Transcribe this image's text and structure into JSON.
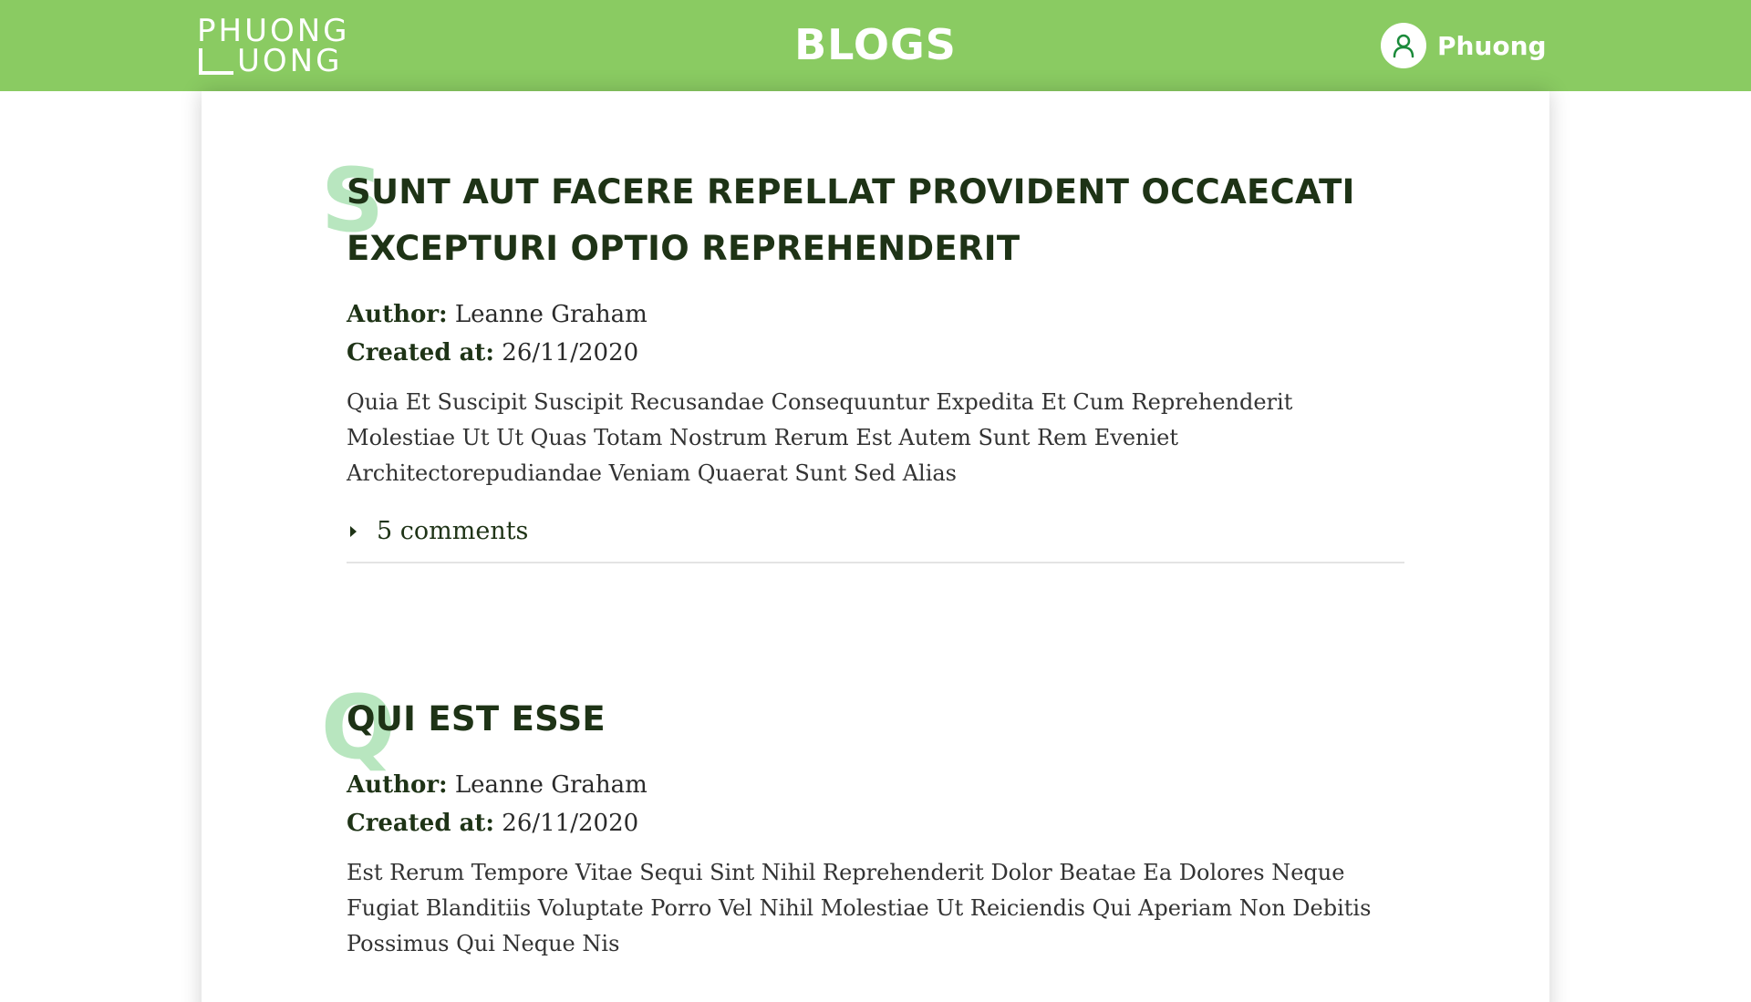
{
  "header": {
    "logo_line1": "PHUONG",
    "logo_line2": "UONG",
    "title": "BLOGS",
    "user_name": "Phuong",
    "user_icon": "user-icon"
  },
  "posts": [
    {
      "initial": "S",
      "title": "SUNT AUT FACERE REPELLAT PROVIDENT OCCAECATI EXCEPTURI OPTIO REPREHENDERIT",
      "author_label": "Author:",
      "author": "Leanne Graham",
      "created_label": "Created at:",
      "created": "26/11/2020",
      "body": "Quia Et Suscipit Suscipit Recusandae Consequuntur Expedita Et Cum Reprehenderit Molestiae Ut Ut Quas Totam Nostrum Rerum Est Autem Sunt Rem Eveniet Architectorepudiandae Veniam Quaerat Sunt Sed Alias",
      "comments_label": "5 comments"
    },
    {
      "initial": "Q",
      "title": "QUI EST ESSE",
      "author_label": "Author:",
      "author": "Leanne Graham",
      "created_label": "Created at:",
      "created": "26/11/2020",
      "body": "Est Rerum Tempore Vitae Sequi Sint Nihil Reprehenderit Dolor Beatae Ea Dolores Neque Fugiat Blanditiis Voluptate Porro Vel Nihil Molestiae Ut Reiciendis Qui Aperiam Non Debitis Possimus Qui Neque Nis"
    }
  ],
  "colors": {
    "header_bg": "#8acb62",
    "accent_letter": "#b8e6bf",
    "title_text": "#1e3316"
  }
}
